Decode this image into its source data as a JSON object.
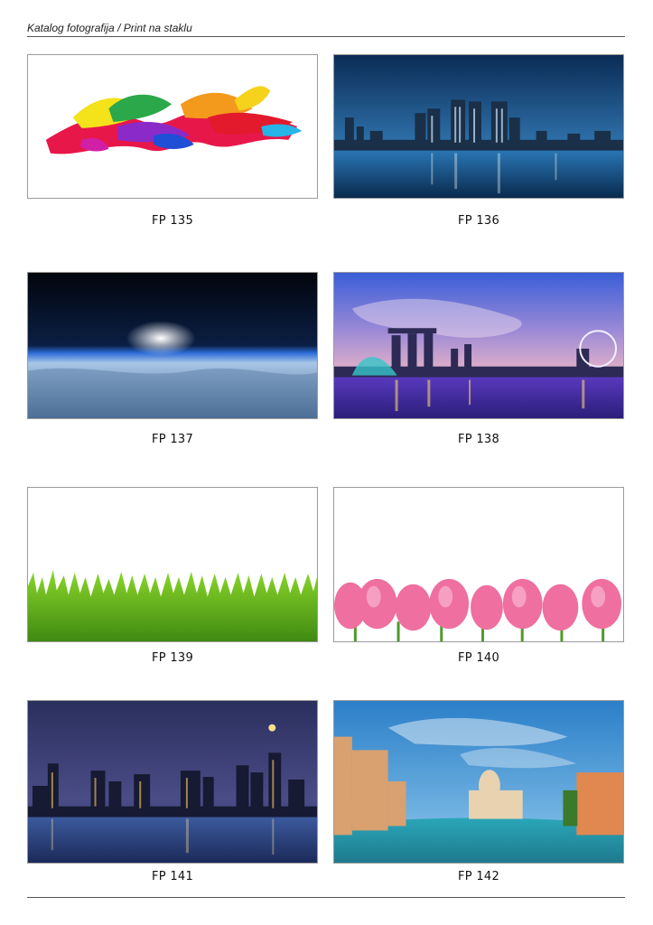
{
  "header": {
    "title": "Katalog fotografija / Print na staklu"
  },
  "items": [
    {
      "code": "FP 135",
      "subject": "paint-splash-icon"
    },
    {
      "code": "FP 136",
      "subject": "city-skyline-icon"
    },
    {
      "code": "FP 137",
      "subject": "earth-horizon-icon"
    },
    {
      "code": "FP 138",
      "subject": "marina-bay-icon"
    },
    {
      "code": "FP 139",
      "subject": "grass-icon"
    },
    {
      "code": "FP 140",
      "subject": "tulips-icon"
    },
    {
      "code": "FP 141",
      "subject": "night-city-icon"
    },
    {
      "code": "FP 142",
      "subject": "venice-canal-icon"
    }
  ]
}
